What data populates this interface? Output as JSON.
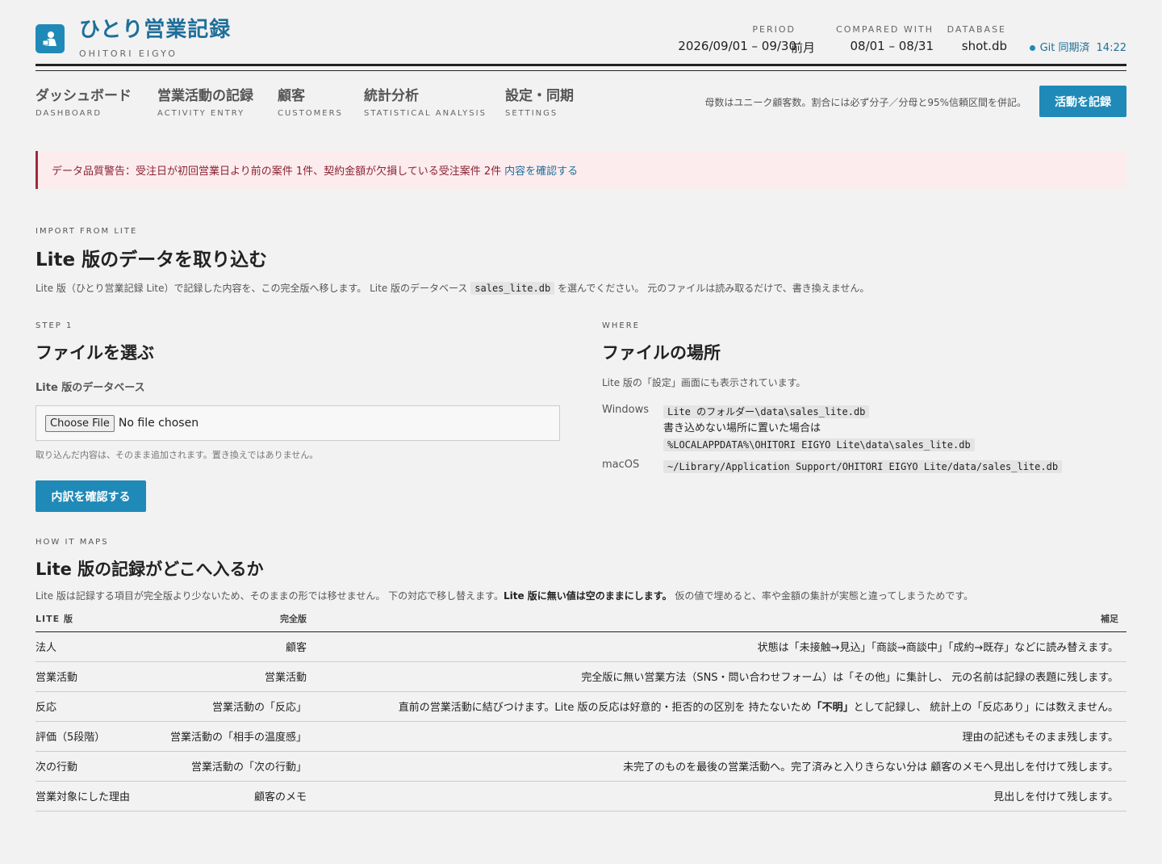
{
  "app": {
    "title": "ひとり営業記録",
    "subtitle": "OHITORI EIGYO",
    "logo_icon": "person-desk-icon"
  },
  "header": {
    "period_label": "PERIOD",
    "period_value": "2026/09/01 – 09/30",
    "compared_label": "COMPARED WITH",
    "compared_prefix": "前月",
    "compared_value": "08/01 – 08/31",
    "database_label": "DATABASE",
    "database_value": "shot.db",
    "git_status": "Git 同期済",
    "git_time": "14:22"
  },
  "nav": {
    "items": [
      {
        "label": "ダッシュボード",
        "sub": "DASHBOARD"
      },
      {
        "label": "営業活動の記録",
        "sub": "ACTIVITY ENTRY"
      },
      {
        "label": "顧客",
        "sub": "CUSTOMERS"
      },
      {
        "label": "統計分析",
        "sub": "STATISTICAL ANALYSIS"
      },
      {
        "label": "設定・同期",
        "sub": "SETTINGS"
      }
    ],
    "note": "母数はユニーク顧客数。割合には必ず分子／分母と95%信頼区間を併記。",
    "record_button": "活動を記録"
  },
  "alert": {
    "text": "データ品質警告：受注日が初回営業日より前の案件 1件、契約金額が欠損している受注案件 2件",
    "link": "内容を確認する"
  },
  "import": {
    "eyebrow": "IMPORT FROM LITE",
    "title": "Lite 版のデータを取り込む",
    "lead_1": "Lite 版（ひとり営業記録 Lite）で記録した内容を、この完全版へ移します。 Lite 版のデータベース",
    "lead_code": "sales_lite.db",
    "lead_2": "を選んでください。 元のファイルは読み取るだけで、書き換えません。"
  },
  "step": {
    "eyebrow": "STEP 1",
    "title": "ファイルを選ぶ",
    "field_label": "Lite 版のデータベース",
    "choose_button": "Choose File",
    "file_status": "No file chosen",
    "hint": "取り込んだ内容は、そのまま追加されます。置き換えではありません。",
    "confirm_button": "内訳を確認する"
  },
  "where": {
    "eyebrow": "WHERE",
    "title": "ファイルの場所",
    "lead": "Lite 版の「設定」画面にも表示されています。",
    "windows_label": "Windows",
    "windows_path": "Lite のフォルダー\\data\\sales_lite.db",
    "windows_note": "書き込めない場所に置いた場合は",
    "windows_alt_path": "%LOCALAPPDATA%\\OHITORI EIGYO Lite\\data\\sales_lite.db",
    "mac_label": "macOS",
    "mac_path": "~/Library/Application Support/OHITORI EIGYO Lite/data/sales_lite.db"
  },
  "mapping": {
    "eyebrow": "HOW IT MAPS",
    "title": "Lite 版の記録がどこへ入るか",
    "lead_1": "Lite 版は記録する項目が完全版より少ないため、そのままの形では移せません。 下の対応で移し替えます。",
    "lead_bold": "Lite 版に無い値は空のままにします。",
    "lead_2": " 仮の値で埋めると、率や金額の集計が実態と違ってしまうためです。",
    "columns": [
      "LITE 版",
      "完全版",
      "補足"
    ],
    "rows": [
      {
        "lite": "法人",
        "full": "顧客",
        "note": "状態は「未接触→見込」「商談→商談中」「成約→既存」などに読み替えます。"
      },
      {
        "lite": "営業活動",
        "full": "営業活動",
        "note": "完全版に無い営業方法（SNS・問い合わせフォーム）は「その他」に集計し、 元の名前は記録の表題に残します。"
      },
      {
        "lite": "反応",
        "full": "営業活動の「反応」",
        "note_a": "直前の営業活動に結びつけます。Lite 版の反応は好意的・拒否的の区別を 持たないため",
        "note_bold": "「不明」",
        "note_b": "として記録し、 統計上の「反応あり」には数えません。"
      },
      {
        "lite": "評価（5段階）",
        "full": "営業活動の「相手の温度感」",
        "note": "理由の記述もそのまま残します。"
      },
      {
        "lite": "次の行動",
        "full": "営業活動の「次の行動」",
        "note": "未完了のものを最後の営業活動へ。完了済みと入りきらない分は 顧客のメモへ見出しを付けて残します。"
      },
      {
        "lite": "営業対象にした理由",
        "full": "顧客のメモ",
        "note": "見出しを付けて残します。"
      }
    ]
  }
}
